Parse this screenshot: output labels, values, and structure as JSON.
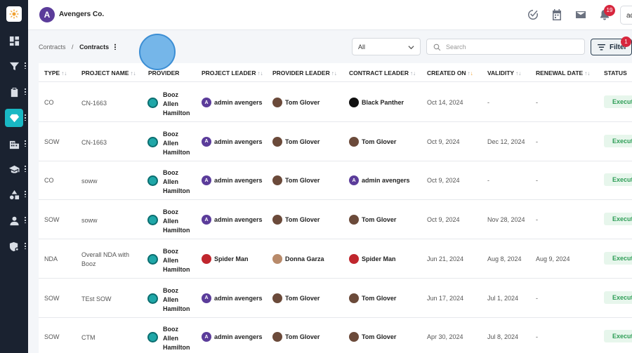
{
  "header": {
    "brand_initial": "A",
    "brand_name": "Avengers Co.",
    "notification_count": "19",
    "user_initials": "ad"
  },
  "breadcrumb": {
    "parent": "Contracts",
    "separator": "/",
    "current": "Contracts"
  },
  "toolbar": {
    "select_value": "All",
    "search_placeholder": "Search",
    "filter_label": "Filter",
    "filter_count": "1"
  },
  "columns": [
    "TYPE",
    "PROJECT NAME",
    "PROVIDER",
    "PROJECT LEADER",
    "PROVIDER LEADER",
    "CONTRACT LEADER",
    "CREATED ON",
    "VALIDITY",
    "RENEWAL DATE",
    "STATUS"
  ],
  "rows": [
    {
      "type": "CO",
      "project_name": [
        "CN-1663"
      ],
      "provider": [
        "Booz",
        "Allen",
        "Hamilton"
      ],
      "project_leader": "admin avengers",
      "provider_leader": "Tom Glover",
      "contract_leader": "Black Panther",
      "created_on": "Oct 14, 2024",
      "validity": "-",
      "renewal_date": "-",
      "status": "Executed"
    },
    {
      "type": "SOW",
      "project_name": [
        "CN-1663"
      ],
      "provider": [
        "Booz",
        "Allen",
        "Hamilton"
      ],
      "project_leader": "admin avengers",
      "provider_leader": "Tom Glover",
      "contract_leader": "Tom Glover",
      "created_on": "Oct 9, 2024",
      "validity": "Dec 12, 2024",
      "renewal_date": "-",
      "status": "Executed"
    },
    {
      "type": "CO",
      "project_name": [
        "soww"
      ],
      "provider": [
        "Booz",
        "Allen",
        "Hamilton"
      ],
      "project_leader": "admin avengers",
      "provider_leader": "Tom Glover",
      "contract_leader": "admin avengers",
      "created_on": "Oct 9, 2024",
      "validity": "-",
      "renewal_date": "-",
      "status": "Executed"
    },
    {
      "type": "SOW",
      "project_name": [
        "soww"
      ],
      "provider": [
        "Booz",
        "Allen",
        "Hamilton"
      ],
      "project_leader": "admin avengers",
      "provider_leader": "Tom Glover",
      "contract_leader": "Tom Glover",
      "created_on": "Oct 9, 2024",
      "validity": "Nov 28, 2024",
      "renewal_date": "-",
      "status": "Executed"
    },
    {
      "type": "NDA",
      "project_name": [
        "Overall NDA with",
        "Booz"
      ],
      "provider": [
        "Booz",
        "Allen",
        "Hamilton"
      ],
      "project_leader": "Spider Man",
      "provider_leader": "Donna Garza",
      "contract_leader": "Spider Man",
      "created_on": "Jun 21, 2024",
      "validity": "Aug 8, 2024",
      "renewal_date": "Aug 9, 2024",
      "status": "Executed"
    },
    {
      "type": "SOW",
      "project_name": [
        "TEst SOW"
      ],
      "provider": [
        "Booz",
        "Allen",
        "Hamilton"
      ],
      "project_leader": "admin avengers",
      "provider_leader": "Tom Glover",
      "contract_leader": "Tom Glover",
      "created_on": "Jun 17, 2024",
      "validity": "Jul 1, 2024",
      "renewal_date": "-",
      "status": "Executed"
    },
    {
      "type": "SOW",
      "project_name": [
        "CTM"
      ],
      "provider": [
        "Booz",
        "Allen",
        "Hamilton"
      ],
      "project_leader": "admin avengers",
      "provider_leader": "Tom Glover",
      "contract_leader": "Tom Glover",
      "created_on": "Apr 30, 2024",
      "validity": "Jul 8, 2024",
      "renewal_date": "-",
      "status": "Executed"
    }
  ],
  "colors": {
    "sidebar_bg": "#1a2230",
    "accent_teal": "#19b8c4",
    "badge_red": "#d7263d",
    "status_green": "#2f9e57"
  },
  "icons": [
    "logo-icon",
    "dashboard-icon",
    "filter-funnel-icon",
    "clipboard-icon",
    "diamond-icon",
    "building-icon",
    "graduation-cap-icon",
    "shapes-icon",
    "user-icon",
    "shield-gear-icon",
    "check-circle-icon",
    "calendar-icon",
    "mail-icon",
    "bell-icon",
    "search-icon",
    "filter-lines-icon",
    "chevron-down-icon"
  ]
}
